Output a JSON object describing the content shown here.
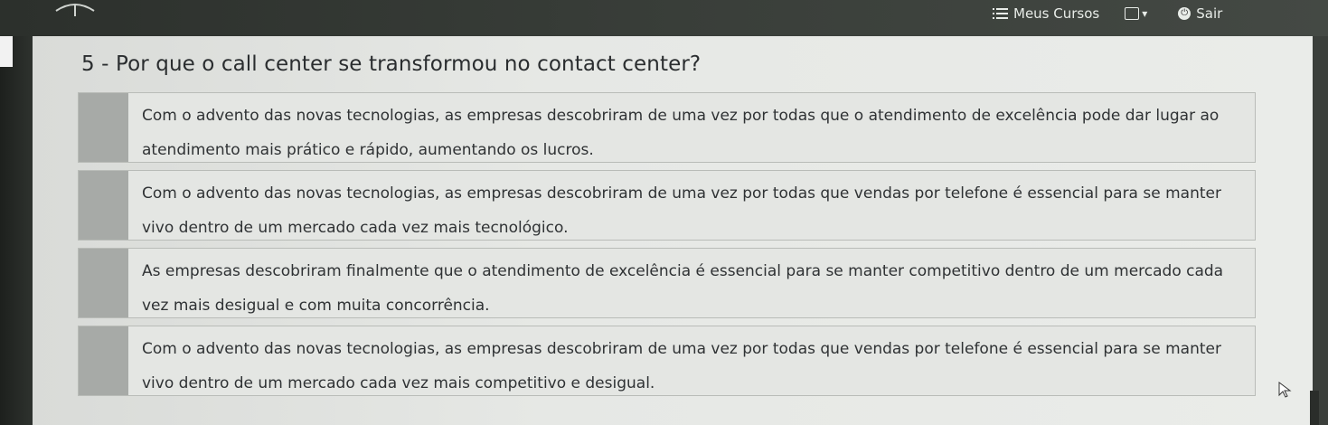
{
  "header": {
    "menu_label": "Meus Cursos",
    "exit_label": "Sair",
    "icons": {
      "menu": "list-icon",
      "language": "language-flag-icon",
      "exit": "power-icon",
      "dropdown": "chevron-down-icon"
    }
  },
  "question": {
    "title": "5 - Por que o call center se transformou no contact center?"
  },
  "options": [
    {
      "text": "Com o advento das novas tecnologias, as empresas descobriram de uma vez por todas que o atendimento de excelência pode dar lugar ao atendimento mais prático e rápido, aumentando os lucros."
    },
    {
      "text": "Com o advento das novas tecnologias, as empresas descobriram de uma vez por todas que vendas por telefone é essencial para se manter vivo dentro de um mercado cada vez mais tecnológico."
    },
    {
      "text": "As empresas descobriram finalmente que o atendimento de excelência é essencial para se manter competitivo dentro de um mercado cada vez mais desigual e com muita concorrência."
    },
    {
      "text": "Com o advento das novas tecnologias, as empresas descobriram de uma vez por todas que vendas por telefone é essencial para se manter vivo dentro de um mercado cada vez mais competitivo e desigual."
    }
  ]
}
